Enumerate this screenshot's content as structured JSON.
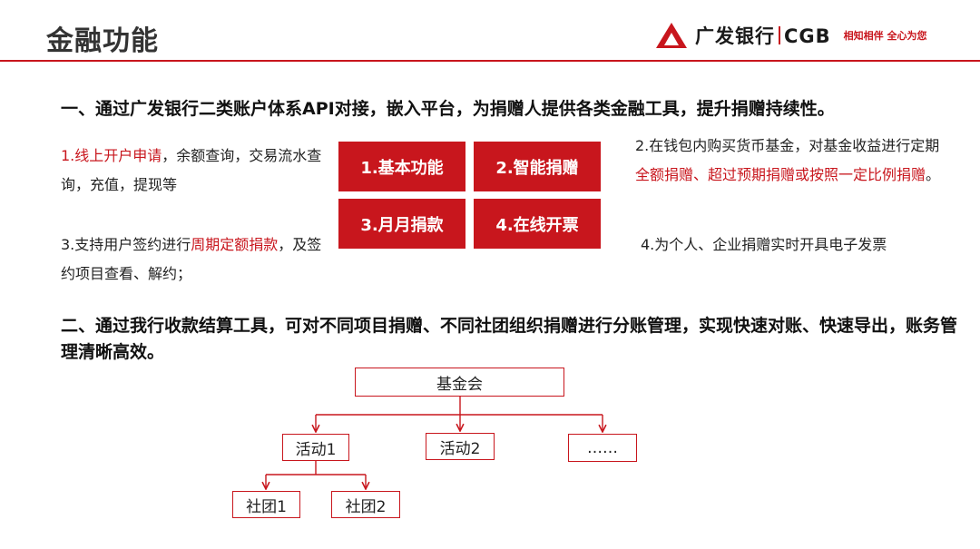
{
  "header": {
    "title": "金融功能",
    "brand_name": "广发银行",
    "brand_code": "CGB",
    "slogan": "相知相伴  全心为您",
    "accent_color": "#c8161d"
  },
  "section1": {
    "heading": "一、通过广发银行二类账户体系API对接，嵌入平台，为捐赠人提供各类金融工具，提升捐赠持续性。",
    "features": [
      {
        "highlight": "1.线上开户申请",
        "before": "",
        "after": "，余额查询，交易流水查询，充值，提现等"
      },
      {
        "before": "2.在钱包内购买货币基金，对基金收益进行定期",
        "highlight": "全额捐赠、超过预期捐赠或按照一定比例捐赠",
        "after": "。"
      },
      {
        "before": "3.支持用户签约进行",
        "highlight": "周期定额捐款",
        "after": "，及签约项目查看、解约；"
      },
      {
        "text": "4.为个人、企业捐赠实时开具电子发票"
      }
    ],
    "boxes": [
      "1.基本功能",
      "2.智能捐赠",
      "3.月月捐款",
      "4.在线开票"
    ]
  },
  "section2": {
    "heading": "二、通过我行收款结算工具，可对不同项目捐赠、不同社团组织捐赠进行分账管理，实现快速对账、快速导出，账务管理清晰高效。",
    "org_tree": {
      "root": "基金会",
      "activities": [
        "活动1",
        "活动2",
        "……"
      ],
      "clubs": [
        "社团1",
        "社团2"
      ]
    }
  }
}
